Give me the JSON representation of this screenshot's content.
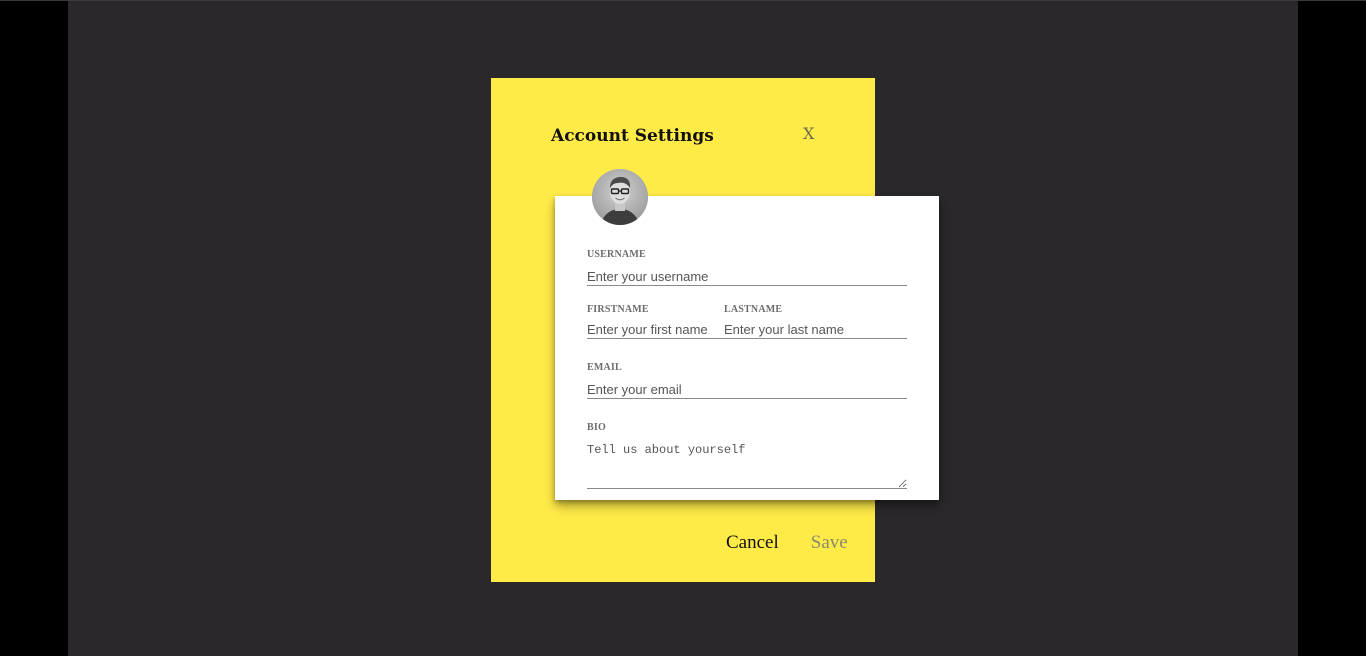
{
  "dialog": {
    "title": "Account Settings",
    "close_label": "X",
    "cancel_label": "Cancel",
    "save_label": "Save"
  },
  "form": {
    "username": {
      "label": "USERNAME",
      "placeholder": "Enter your username",
      "value": ""
    },
    "firstname": {
      "label": "FIRSTNAME",
      "placeholder": "Enter your first name",
      "value": ""
    },
    "lastname": {
      "label": "LASTNAME",
      "placeholder": "Enter your last name",
      "value": ""
    },
    "email": {
      "label": "EMAIL",
      "placeholder": "Enter your email",
      "value": ""
    },
    "bio": {
      "label": "BIO",
      "placeholder": "Tell us about yourself",
      "value": ""
    }
  },
  "colors": {
    "backdrop": "#2a282b",
    "panel": "#ffeb48",
    "card": "#ffffff"
  },
  "icons": {
    "avatar": "user-avatar-photo",
    "close": "close-icon"
  }
}
